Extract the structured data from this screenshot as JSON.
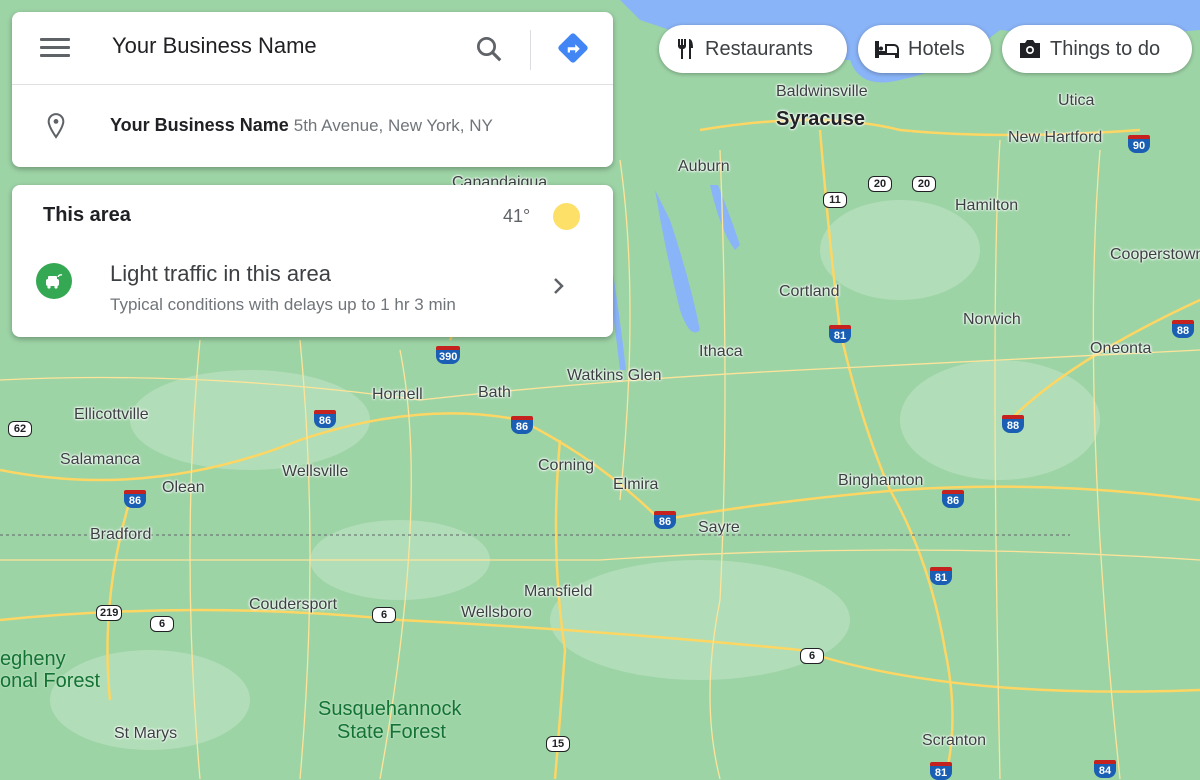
{
  "search": {
    "value": "Your Business Name",
    "suggestion_name": "Your Business Name",
    "suggestion_address": "5th Avenue, New York, NY"
  },
  "area": {
    "title": "This area",
    "temperature": "41°",
    "weather_icon": "sun",
    "traffic_title": "Light traffic in this area",
    "traffic_subtitle": "Typical conditions with delays up to 1 hr 3 min"
  },
  "chips": [
    {
      "label": "Restaurants",
      "icon": "fork-knife"
    },
    {
      "label": "Hotels",
      "icon": "bed"
    },
    {
      "label": "Things to do",
      "icon": "camera"
    }
  ],
  "colors": {
    "land": "#9dd4a6",
    "water": "#8ab4f8",
    "road": "#fdd663",
    "directions": "#4285f4",
    "traffic": "#34a853"
  },
  "map": {
    "places": [
      "Baldwinsville",
      "Syracuse",
      "Utica",
      "New Hartford",
      "Auburn",
      "Canandaigua",
      "Hamilton",
      "Cooperstown",
      "Cortland",
      "Norwich",
      "Ithaca",
      "Watkins Glen",
      "Oneonta",
      "Hornell",
      "Bath",
      "Ellicottville",
      "Salamanca",
      "Wellsville",
      "Corning",
      "Elmira",
      "Binghamton",
      "Olean",
      "Sayre",
      "Bradford",
      "Mansfield",
      "Coudersport",
      "Wellsboro",
      "St Marys",
      "Scranton"
    ],
    "parks": [
      "egheny",
      "onal Forest",
      "Susquehannock",
      "State Forest"
    ],
    "routes": [
      "90",
      "20",
      "20",
      "11",
      "81",
      "88",
      "390",
      "86",
      "86",
      "62",
      "86",
      "86",
      "86",
      "88",
      "81",
      "86",
      "219",
      "6",
      "6",
      "6",
      "15",
      "81",
      "84"
    ]
  }
}
